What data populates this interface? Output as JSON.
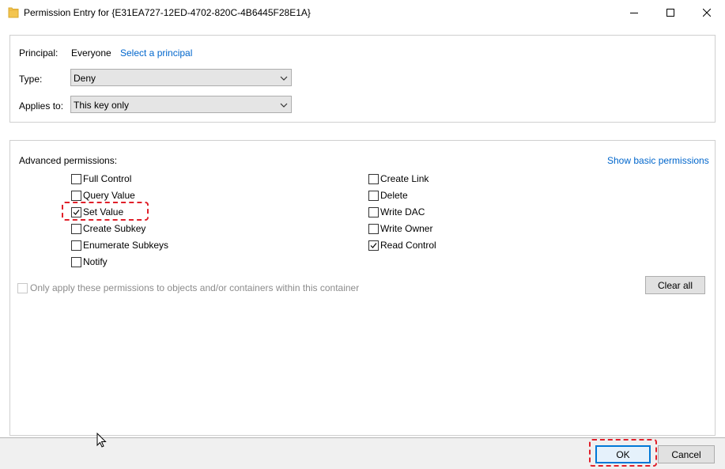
{
  "window": {
    "title": "Permission Entry for {E31EA727-12ED-4702-820C-4B6445F28E1A}",
    "icon": "folder-icon"
  },
  "principal": {
    "label": "Principal:",
    "value": "Everyone",
    "link": "Select a principal"
  },
  "type": {
    "label": "Type:",
    "selected": "Deny"
  },
  "applies_to": {
    "label": "Applies to:",
    "selected": "This key only"
  },
  "advanced": {
    "heading": "Advanced permissions:",
    "show_basic_link": "Show basic permissions",
    "left_permissions": [
      {
        "label": "Full Control",
        "checked": false
      },
      {
        "label": "Query Value",
        "checked": false
      },
      {
        "label": "Set Value",
        "checked": true
      },
      {
        "label": "Create Subkey",
        "checked": false
      },
      {
        "label": "Enumerate Subkeys",
        "checked": false
      },
      {
        "label": "Notify",
        "checked": false
      }
    ],
    "right_permissions": [
      {
        "label": "Create Link",
        "checked": false
      },
      {
        "label": "Delete",
        "checked": false
      },
      {
        "label": "Write DAC",
        "checked": false
      },
      {
        "label": "Write Owner",
        "checked": false
      },
      {
        "label": "Read Control",
        "checked": true
      }
    ],
    "only_apply": {
      "label": "Only apply these permissions to objects and/or containers within this container",
      "checked": false,
      "enabled": false
    },
    "clear_all_label": "Clear all"
  },
  "footer": {
    "ok_label": "OK",
    "cancel_label": "Cancel"
  },
  "colors": {
    "link": "#0066cc",
    "highlight": "#e0202a",
    "default_button_border": "#0078d7"
  }
}
